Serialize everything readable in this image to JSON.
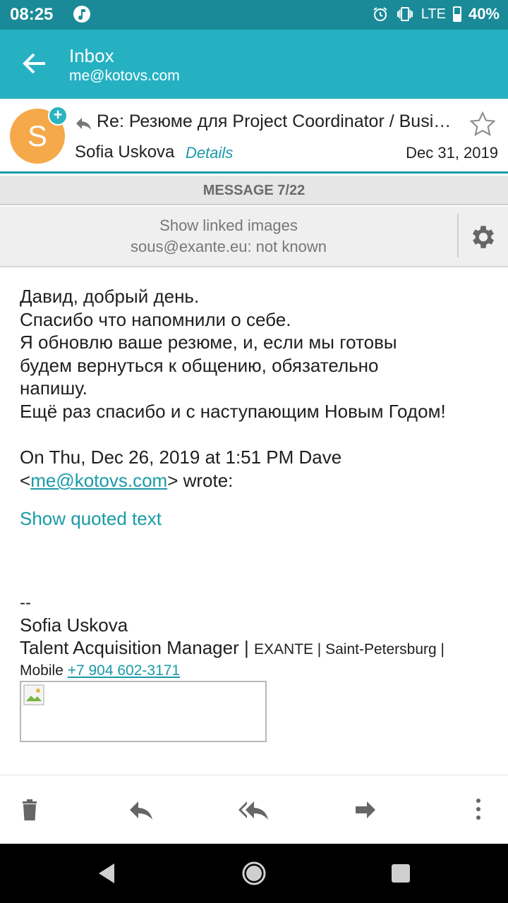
{
  "status_bar": {
    "time": "08:25",
    "network": "LTE",
    "battery": "40%",
    "icons": [
      "music-icon",
      "alarm-icon",
      "vibrate-icon",
      "signal-icon",
      "battery-icon"
    ]
  },
  "app_bar": {
    "title": "Inbox",
    "account": "me@kotovs.com"
  },
  "header": {
    "avatar_letter": "S",
    "subject": "Re: Резюме для Project Coordinator / Business Analyst",
    "sender": "Sofia Uskova",
    "details_label": "Details",
    "date": "Dec 31, 2019"
  },
  "message_counter": "MESSAGE 7/22",
  "images_banner": {
    "show_label": "Show linked images",
    "sender_status": "sous@exante.eu: not known"
  },
  "body": {
    "lines": [
      "Давид, добрый день.",
      "Спасибо что напомнили о себе.",
      "Я обновлю ваше резюме, и, если мы готовы",
      "будем вернуться к общению, обязательно",
      "напишу.",
      "Ещё раз спасибо и с наступающим Новым Годом!"
    ],
    "quote_header_line1": "On Thu, Dec 26, 2019 at 1:51 PM Dave",
    "quote_open": "<",
    "quote_email": "me@kotovs.com",
    "quote_close": "> wrote:",
    "show_quoted": "Show quoted text"
  },
  "signature": {
    "dash": "--",
    "name": "Sofia Uskova",
    "title": "Talent Acquisition Manager",
    "sep": " | ",
    "company_location": "EXANTE | Saint-Petersburg |",
    "mobile_label": "Mobile ",
    "phone": "+7 904 602-3171"
  },
  "actions": [
    "delete-button",
    "reply-button",
    "reply-all-button",
    "forward-button",
    "more-button"
  ],
  "colors": {
    "status_bar": "#1a8a98",
    "app_bar": "#25b1c2",
    "accent": "#1a9aa8",
    "avatar": "#f6a94a"
  }
}
